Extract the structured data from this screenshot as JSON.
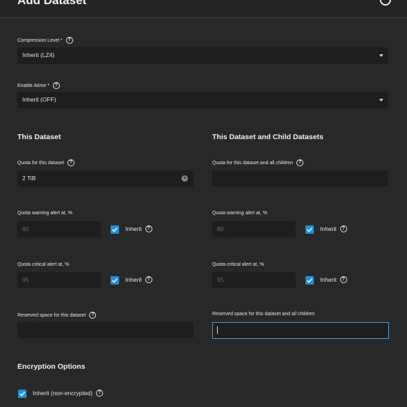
{
  "header": {
    "title": "Add Dataset"
  },
  "compression": {
    "label": "Compression Level *",
    "value": "Inherit (LZ4)"
  },
  "atime": {
    "label": "Enable Atime *",
    "value": "Inherit (OFF)"
  },
  "this_dataset": {
    "title": "This Dataset",
    "quota_label": "Quota for this dataset",
    "quota_value": "2 TiB",
    "warning_label": "Quota warning alert at, %",
    "warning_value": "80",
    "warning_inherit": "Inherit",
    "critical_label": "Quota critical alert at, %",
    "critical_value": "95",
    "critical_inherit": "Inherit",
    "reserved_label": "Reserved space for this dataset",
    "reserved_value": ""
  },
  "children": {
    "title": "This Dataset and Child Datasets",
    "quota_label": "Quota for this dataset and all children",
    "quota_value": "",
    "warning_label": "Quota warning alert at, %",
    "warning_value": "80",
    "warning_inherit": "Inherit",
    "critical_label": "Quota critical alert at, %",
    "critical_value": "95",
    "critical_inherit": "Inherit",
    "reserved_label": "Reserved space for this dataset and all children",
    "reserved_value": ""
  },
  "encryption": {
    "title": "Encryption Options",
    "inherit_label": "Inherit (non-encrypted)"
  },
  "help_glyph": "?",
  "colors": {
    "accent": "#1f8fde",
    "background": "#282828",
    "field": "#1e1e1e",
    "focus": "#4a9fd8"
  }
}
